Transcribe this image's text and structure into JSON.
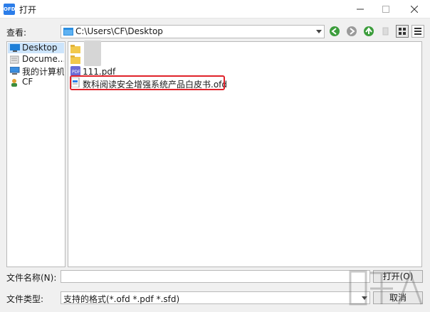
{
  "window": {
    "title": "打开",
    "app_icon_text": "OFD",
    "accent": "#2b7de9"
  },
  "toolbar": {
    "lookin_label": "查看:",
    "path": "C:\\Users\\CF\\Desktop",
    "icons": [
      "back-icon",
      "forward-icon",
      "up-folder-icon",
      "new-folder-icon",
      "thumbnail-view-icon",
      "list-view-icon"
    ]
  },
  "places": {
    "items": [
      {
        "label": "Desktop",
        "icon": "desktop-icon",
        "selected": true
      },
      {
        "label": "Docume...",
        "icon": "documents-icon",
        "selected": false
      },
      {
        "label": "我的计算机",
        "icon": "computer-icon",
        "selected": false
      },
      {
        "label": "CF",
        "icon": "user-icon",
        "selected": false
      }
    ]
  },
  "files": {
    "items": [
      {
        "label": "",
        "icon": "folder-icon"
      },
      {
        "label": "",
        "icon": "folder-icon"
      },
      {
        "label": "111.pdf",
        "icon": "pdf-file-icon"
      },
      {
        "label": "数科阅读安全增强系统产品白皮书.ofd",
        "icon": "ofd-file-icon",
        "highlighted": true
      }
    ],
    "highlight_color": "#e0222a"
  },
  "footer": {
    "filename_label": "文件名称(N):",
    "filename_value": "",
    "open_button": "打开(O)",
    "filetype_label": "文件类型:",
    "filetype_value": "支持的格式(*.ofd *.pdf *.sfd)",
    "cancel_button": "取消"
  }
}
